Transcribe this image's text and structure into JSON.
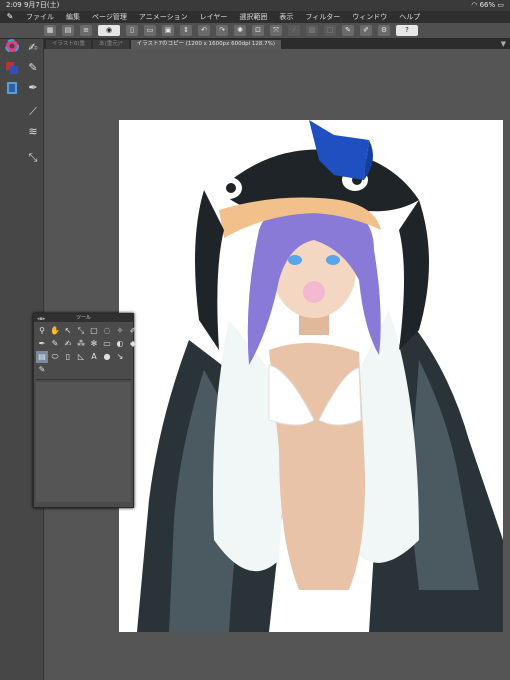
{
  "status_bar": {
    "time": "2:09",
    "date": "9月7日(土)",
    "battery": "66%"
  },
  "menu": [
    "ファイル",
    "編集",
    "ページ管理",
    "アニメーション",
    "レイヤー",
    "選択範囲",
    "表示",
    "フィルター",
    "ウィンドウ",
    "ヘルプ"
  ],
  "tabs": [
    {
      "label": "イラスト6(重",
      "active": false
    },
    {
      "label": "あ(重元)*",
      "active": false
    },
    {
      "label": "イラスト7のコピー (1200 x 1600px 600dpi 128.7%)",
      "active": true
    }
  ],
  "tool_panel": {
    "title": "ツール"
  },
  "toolbar": {
    "icons": [
      "grid-icon",
      "new-icon",
      "open-icon",
      "save-icon",
      "undo-icon",
      "redo-icon",
      "transform-icon",
      "clear-icon",
      "fill-icon",
      "settings-icon",
      "help-icon"
    ],
    "help_label": "?"
  },
  "colors": {
    "accent_selected": "#7a8ba0",
    "canvas_bg": "#555555",
    "paper": "#ffffff",
    "hood_blue": "#1f4fc0",
    "hair": "#8a7ad8"
  }
}
